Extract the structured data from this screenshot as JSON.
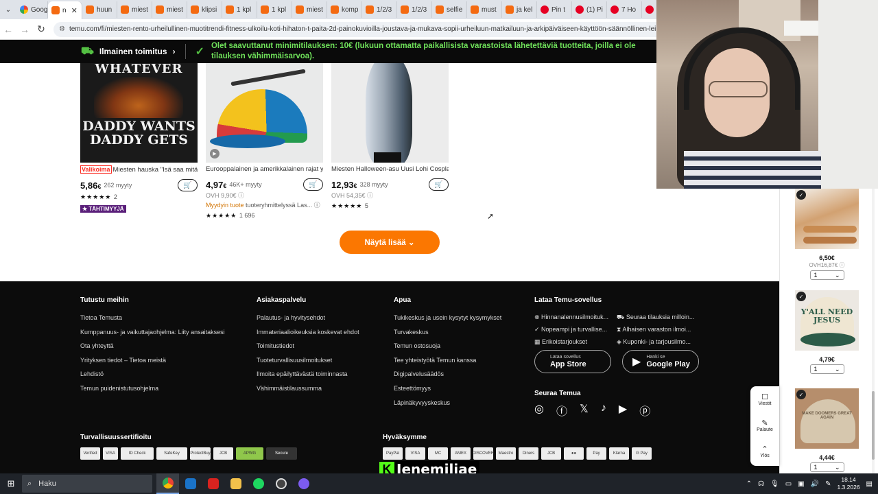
{
  "browser": {
    "tabs": [
      {
        "icon": "google",
        "label": "Goog"
      },
      {
        "icon": "temu",
        "label": "n",
        "active": true
      },
      {
        "icon": "temu",
        "label": "huun"
      },
      {
        "icon": "temu",
        "label": "miest"
      },
      {
        "icon": "temu",
        "label": "miest"
      },
      {
        "icon": "temu",
        "label": "klipsi"
      },
      {
        "icon": "temu",
        "label": "1 kpl"
      },
      {
        "icon": "temu",
        "label": "1 kpl"
      },
      {
        "icon": "temu",
        "label": "miest"
      },
      {
        "icon": "temu",
        "label": "komp"
      },
      {
        "icon": "temu",
        "label": "1/2/3"
      },
      {
        "icon": "temu",
        "label": "1/2/3"
      },
      {
        "icon": "temu",
        "label": "selfie"
      },
      {
        "icon": "temu",
        "label": "must"
      },
      {
        "icon": "temu",
        "label": "ja kel"
      },
      {
        "icon": "pinterest",
        "label": "Pin t"
      },
      {
        "icon": "pinterest",
        "label": "(1) Pi"
      },
      {
        "icon": "pinterest",
        "label": "7 Ho"
      },
      {
        "icon": "pinterest",
        "label": ""
      }
    ],
    "close_glyph": "✕",
    "url": "temu.com/fi/miesten-rento-urheilullinen-muotitrendi-fitness-ulkoilu-koti-hihaton-t-paita-2d-painokuvioilla-joustava-ja-mukava-sopii-urheiluun-matkailuun-ja-arkipäiväiseen-käyttöön-säännöllinen-leikkaus-p"
  },
  "shipping": {
    "free_label": "Ilmainen toimitus",
    "message": "Olet saavuttanut minimitilauksen: 10€ (lukuun ottamatta paikallisista varastoista lähetettäviä tuotteita, joilla ei ole tilauksen vähimmäisarvoa)."
  },
  "products": [
    {
      "shirt_top": "WHATEVER",
      "shirt_bottom_1": "DADDY WANTS",
      "shirt_bottom_2": "DADDY GETS",
      "badge": "Valikoima",
      "title": "Miesten hauska \"Isä saa mitä h...",
      "price_main": "5,86",
      "price_sub": "€",
      "sold": "262 myyty",
      "stars": "★★★★★",
      "rating_count": "2",
      "tag": "★ TÄHTIMYYJÄ"
    },
    {
      "title": "Eurooppalainen ja amerikkalainen rajat ylit...",
      "price_main": "4,97",
      "price_sub": "€",
      "sold": "46K+ myyty",
      "orig": "OVH 9,90€ ⓘ",
      "myyty_highlight": "Myydyin tuote",
      "myyty_rest": " tuoteryhmittelyssä Las... ⓘ",
      "stars": "★★★★★",
      "rating_count": "1 696"
    },
    {
      "title": "Miesten Halloween-asu Uusi Lohi Cosplay-...",
      "price_main": "12,93",
      "price_sub": "€",
      "sold": "328 myyty",
      "orig": "OVH 54,35€ ⓘ",
      "stars": "★★★★★",
      "rating_count": "5"
    }
  ],
  "show_more": "Näytä lisää ⌄",
  "footer": {
    "col1": {
      "heading": "Tutustu meihin",
      "links": [
        "Tietoa Temusta",
        "Kumppanuus- ja vaikuttajaohjelma: Liity ansaitaksesi",
        "Ota yhteyttä",
        "Yrityksen tiedot –  Tietoa meistä",
        "Lehdistö",
        "Temun puidenistutusohjelma"
      ]
    },
    "col2": {
      "heading": "Asiakaspalvelu",
      "links": [
        "Palautus- ja hyvitysehdot",
        "Immateriaalioikeuksia koskevat ehdot",
        "Toimitustiedot",
        "Tuoteturvallisuusilmoitukset",
        "Ilmoita epäilyttävästä toiminnasta",
        "Vähimmäistilaussumma"
      ]
    },
    "col3": {
      "heading": "Apua",
      "links": [
        "Tukikeskus ja usein kysytyt kysymykset",
        "Turvakeskus",
        "Temun ostosuoja",
        "Tee yhteistyötä Temun kanssa",
        "Digipalvelusäädös",
        "Esteettömyys",
        "Läpinäkyvyyskeskus"
      ]
    },
    "app": {
      "heading": "Lataa Temu-sovellus",
      "features": [
        "⊗ Hinnanalennusilmoituk...",
        "⛟ Seuraa tilauksia milloin...",
        "✓ Nopeampi ja turvallise...",
        "⧗ Alhaisen varaston ilmoi...",
        "▦ Erikoistarjoukset",
        "◈ Kuponki- ja tarjousilmo..."
      ],
      "appstore_small": "Lataa sovellus",
      "appstore_big": "App Store",
      "gplay_small": "Hanki se",
      "gplay_big": "Google Play"
    },
    "follow": "Seuraa Temua",
    "security_heading": "Turvallisuussertifioitu",
    "security_logos": [
      "Verified",
      "VISA",
      "ID Check",
      "SafeKey",
      "ProtectBuy",
      "JCB",
      "APWG",
      "Secure"
    ],
    "accept_heading": "Hyväksymme",
    "pay_logos": [
      "PayPal",
      "VISA",
      "MC",
      "AMEX",
      "DISCOVER",
      "Maestro",
      "Diners",
      "JCB",
      "●●",
      "Pay",
      "Klarna",
      "G Pay"
    ]
  },
  "streamer": {
    "k": "K",
    "name": "Jenemiliae"
  },
  "sidebar": {
    "items": [
      {
        "price": "6,50€",
        "orig": "OVH16,87€ ⓘ",
        "qty": "1"
      },
      {
        "cap_text": "Y'ALL NEED JESUS",
        "price": "4,79€",
        "qty": "1"
      },
      {
        "cap_text": "MAKE DOOMERS GREAT AGAIN",
        "price": "4,44€",
        "qty": "1"
      }
    ],
    "menu": [
      {
        "icon": "☐",
        "label": "Viestit"
      },
      {
        "icon": "✎",
        "label": "Palaute"
      },
      {
        "icon": "⌃",
        "label": "Ylös"
      }
    ]
  },
  "taskbar": {
    "search_placeholder": "Haku",
    "time": "18.14",
    "date": "1.3.2026"
  },
  "colors": {
    "temu_orange": "#fb7701",
    "banner_green": "#6fe05a",
    "kick_green": "#53fc18"
  }
}
